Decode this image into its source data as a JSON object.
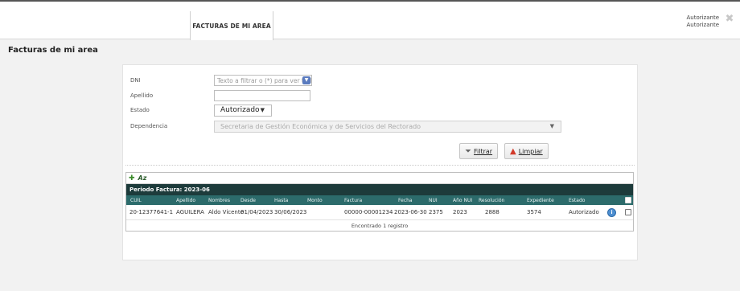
{
  "header": {
    "active_tab": "FACTURAS DE MI AREA",
    "user_line1": "Autorizante",
    "user_line2": "Autorizante"
  },
  "page": {
    "title": "Facturas de mi area"
  },
  "filters": {
    "dni_label": "DNI",
    "dni_placeholder": "Texto a filtrar o (*) para ver todo",
    "apellido_label": "Apellido",
    "apellido_value": "",
    "estado_label": "Estado",
    "estado_value": "Autorizado",
    "dependencia_label": "Dependencia",
    "dependencia_value": "Secretaria de Gestión Económica y de Servicios del Rectorado",
    "filter_button": "Filtrar",
    "clear_button": "Limpiar"
  },
  "grid": {
    "group_label": "Periodo Factura: 2023-06",
    "columns": [
      "CUIL",
      "Apellido",
      "Nombres",
      "Desde",
      "Hasta",
      "Monto",
      "Factura",
      "Fecha",
      "NUI",
      "Año NUI",
      "Resolución",
      "Expediente",
      "Estado"
    ],
    "rows": [
      {
        "cuil": "20-12377641-1",
        "apellido": "AGUILERA",
        "nombres": "Aldo Vicente",
        "desde": "01/04/2023",
        "hasta": "30/06/2023",
        "monto": "",
        "factura": "00000-00001234",
        "fecha": "2023-06-30",
        "nui": "2375",
        "anio_nui": "2023",
        "resolucion": "2888",
        "expediente": "3574",
        "estado": "Autorizado"
      }
    ],
    "footer": "Encontrado 1 registro"
  },
  "icons": {
    "close": "close-icon",
    "dropdown": "chevron-down-icon",
    "filter": "funnel-icon",
    "clear": "eraser-icon",
    "add": "add-icon",
    "sort": "sort-az-icon",
    "view": "view-icon"
  },
  "colors": {
    "group_header": "#1d3b3b",
    "column_header": "#2c6b6b",
    "dropdown_button": "#5a7bbf",
    "view_button": "#4d8ed0"
  }
}
